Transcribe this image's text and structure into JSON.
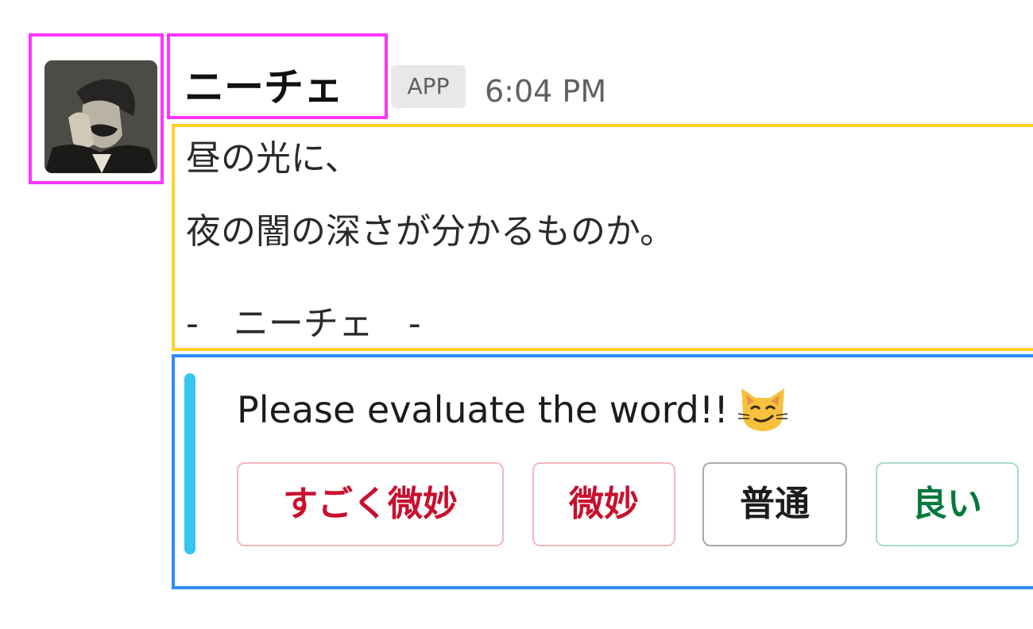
{
  "message": {
    "author": "ニーチェ",
    "badge": "APP",
    "time": "6:04 PM",
    "avatar_icon": "portrait-avatar-icon",
    "lines": [
      "昼の光に、",
      "夜の闇の深さが分かるものか。",
      "",
      "-　ニーチェ　-"
    ]
  },
  "attachment": {
    "text": "Please evaluate the word!!",
    "emoji_icon": "smirking-cat-icon",
    "accent_color": "#36c5f0",
    "buttons": [
      {
        "label": "すごく微妙",
        "style": "danger"
      },
      {
        "label": "微妙",
        "style": "danger"
      },
      {
        "label": "普通",
        "style": "default"
      },
      {
        "label": "良い",
        "style": "primary"
      }
    ]
  },
  "highlight_colors": {
    "author": "#ff33ff",
    "text": "#ffd02a",
    "attachment": "#2d8cff"
  }
}
